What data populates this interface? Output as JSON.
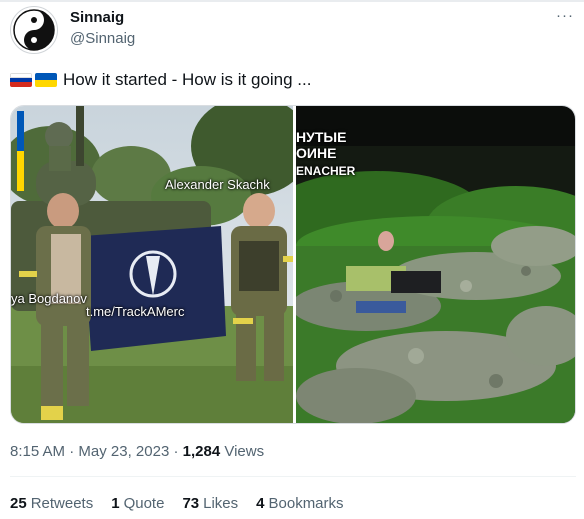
{
  "author": {
    "display_name": "Sinnaig",
    "handle": "@Sinnaig",
    "avatar_icon": "yin-yang-icon"
  },
  "tweet": {
    "flags": [
      "russia-flag-icon",
      "ukraine-flag-icon"
    ],
    "text": "How it started - How is it going ..."
  },
  "media": {
    "left_overlays": {
      "name_right": "Alexander Skachk",
      "name_left": "ya Bogdanov",
      "link": "t.me/TrackAMerc"
    },
    "right_overlays": {
      "line1": "НУТЫЕ",
      "line2": "ОИНЕ",
      "line3": "ENACHER"
    }
  },
  "meta": {
    "time": "8:15 AM",
    "separator": " · ",
    "date": "May 23, 2023",
    "views_count": "1,284",
    "views_label": "Views"
  },
  "stats": [
    {
      "count": "25",
      "label": "Retweets"
    },
    {
      "count": "1",
      "label": "Quote"
    },
    {
      "count": "73",
      "label": "Likes"
    },
    {
      "count": "4",
      "label": "Bookmarks"
    }
  ],
  "colors": {
    "secondary_text": "#536471",
    "primary_text": "#0f1419"
  }
}
